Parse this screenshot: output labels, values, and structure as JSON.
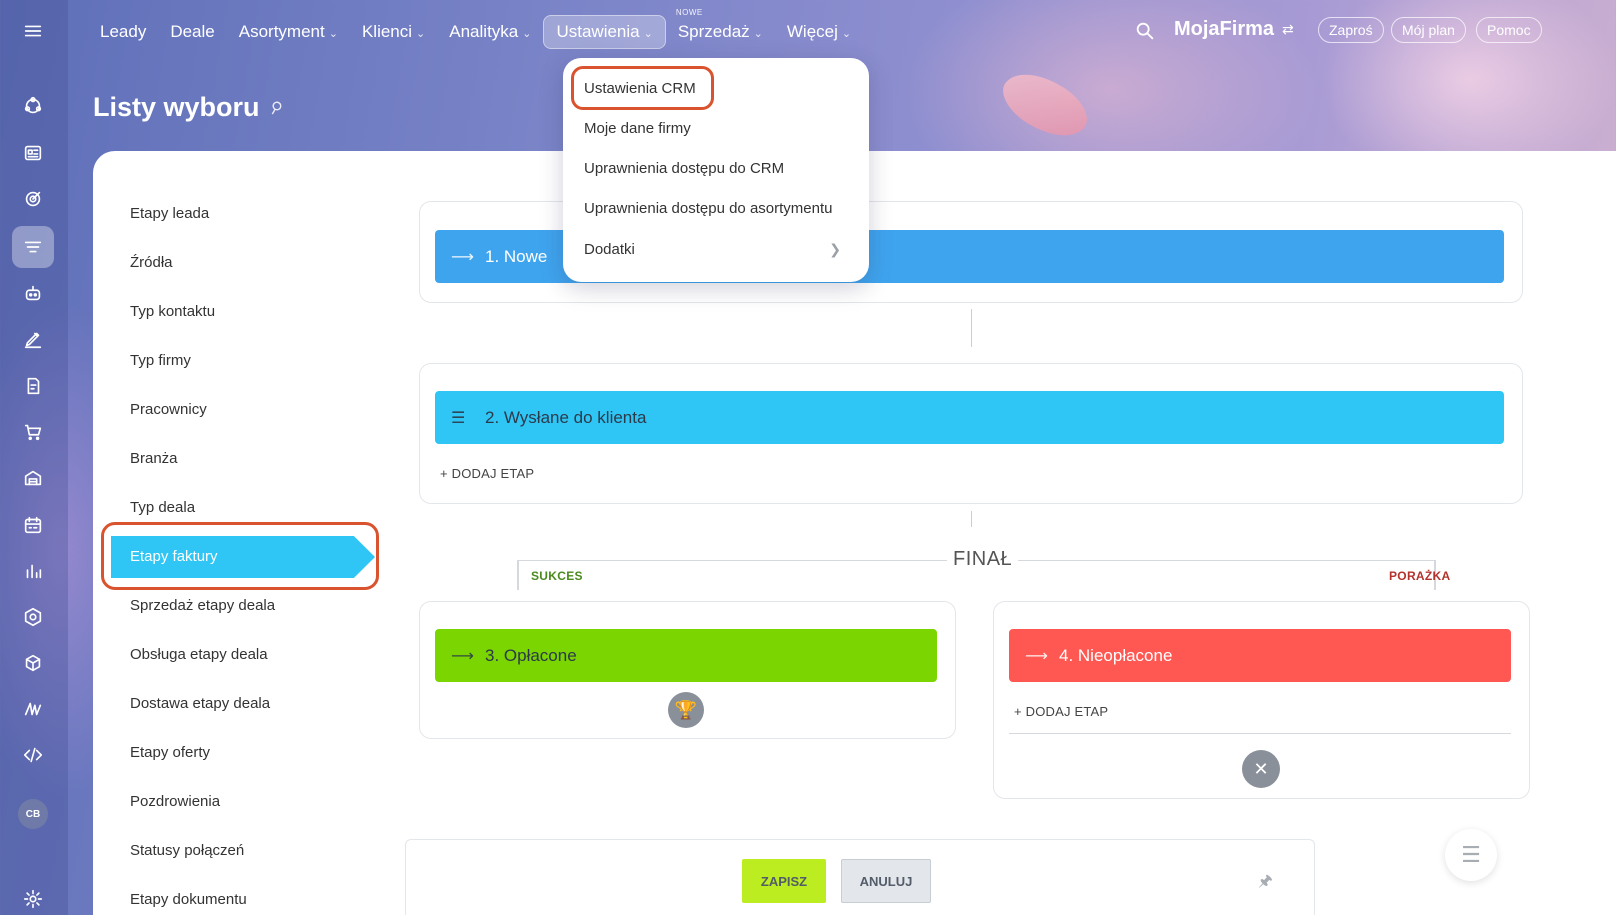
{
  "topnav": {
    "items": [
      {
        "label": "Leady",
        "has_chevron": false
      },
      {
        "label": "Deale",
        "has_chevron": false
      },
      {
        "label": "Asortyment",
        "has_chevron": true
      },
      {
        "label": "Klienci",
        "has_chevron": true
      },
      {
        "label": "Analityka",
        "has_chevron": true
      },
      {
        "label": "Ustawienia",
        "has_chevron": true,
        "active": true
      },
      {
        "label": "Sprzedaż",
        "has_chevron": true,
        "badge": "NOWE"
      },
      {
        "label": "Więcej",
        "has_chevron": true
      }
    ],
    "company": "MojaFirma",
    "invite": "Zaproś",
    "plan": "Mój plan",
    "help": "Pomoc"
  },
  "page": {
    "title": "Listy wyboru"
  },
  "side_menu": [
    "Etapy leada",
    "Źródła",
    "Typ kontaktu",
    "Typ firmy",
    "Pracownicy",
    "Branża",
    "Typ deala",
    "Etapy faktury",
    "Sprzedaż etapy deala",
    "Obsługa etapy deala",
    "Dostawa etapy deala",
    "Etapy oferty",
    "Pozdrowienia",
    "Statusy połączeń",
    "Etapy dokumentu"
  ],
  "side_menu_selected": "Etapy faktury",
  "stages": {
    "s1": {
      "name": "1. Nowe",
      "color": "#3fa4ee"
    },
    "s2": {
      "name": "2. Wysłane do klienta",
      "color": "#2fc6f6"
    },
    "s3": {
      "name": "3. Opłacone",
      "color": "#7bd500"
    },
    "s4": {
      "name": "4. Nieopłacone",
      "color": "#ff5752"
    }
  },
  "add_stage": "+ DODAJ ETAP",
  "final": {
    "title": "FINAŁ",
    "success": "SUKCES",
    "failure": "PORAŻKA"
  },
  "buttons": {
    "save": "ZAPISZ",
    "cancel": "ANULUJ"
  },
  "dropdown": {
    "items": [
      "Ustawienia CRM",
      "Moje dane firmy",
      "Uprawnienia dostępu do CRM",
      "Uprawnienia dostępu do asortymentu",
      "Dodatki"
    ]
  },
  "rail": {
    "avatar": "CB"
  },
  "colors": {
    "accent": "#2fc6f6",
    "highlight": "#d9532f",
    "save": "#bbed21"
  }
}
